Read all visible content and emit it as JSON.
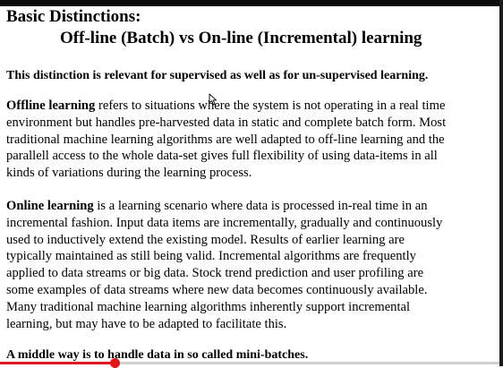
{
  "slide": {
    "title": "Basic Distinctions:",
    "subtitle": "Off-line (Batch) vs On-line (Incremental) learning",
    "intro": "This distinction is relevant for supervised  as well as for un-supervised learning.",
    "offline": {
      "term": "Offline learning",
      "lines": [
        " refers to situations where the system is not operating in a real time",
        "environment but handles pre-harvested data in static and complete  batch form. Most",
        "traditional machine learning algorithms are well adapted to off-line learning and the",
        "parallell access to the whole data-set gives full flexibility of using data-items in all",
        "kinds of variations during the learning process."
      ]
    },
    "online": {
      "term": "Online learning",
      "lines": [
        " is a learning scenario where data is processed in-real time in an",
        "incremental fashion. Input data items are incrementally, gradually  and continuously",
        "used to inductively extend the existing model. Results of earlier learning are",
        "typically maintained as still being valid. Incremental algorithms are frequently",
        "applied to data streams or big data. Stock trend prediction and user profiling are",
        "some examples of data streams where new data becomes continuously available.",
        "Many traditional machine learning algorithms inherently support incremental",
        "learning, but may have to be adapted to facilitate this."
      ]
    },
    "footer": "A middle way is to handle data in so called mini-batches."
  },
  "player": {
    "progress": 0.23,
    "accent_color": "#e0161b"
  },
  "icons": {
    "cursor": "mouse-pointer-icon"
  }
}
